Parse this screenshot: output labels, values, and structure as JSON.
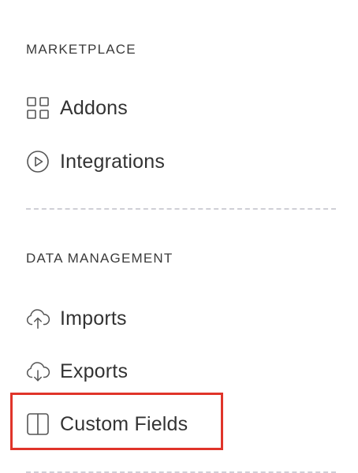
{
  "sections": {
    "marketplace": {
      "title": "MARKETPLACE",
      "items": [
        {
          "label": "Addons",
          "icon": "grid-icon"
        },
        {
          "label": "Integrations",
          "icon": "play-circle-icon"
        }
      ]
    },
    "data_management": {
      "title": "DATA MANAGEMENT",
      "items": [
        {
          "label": "Imports",
          "icon": "cloud-upload-icon"
        },
        {
          "label": "Exports",
          "icon": "cloud-download-icon"
        },
        {
          "label": "Custom Fields",
          "icon": "columns-icon"
        }
      ]
    }
  },
  "highlight_color": "#e0342a"
}
